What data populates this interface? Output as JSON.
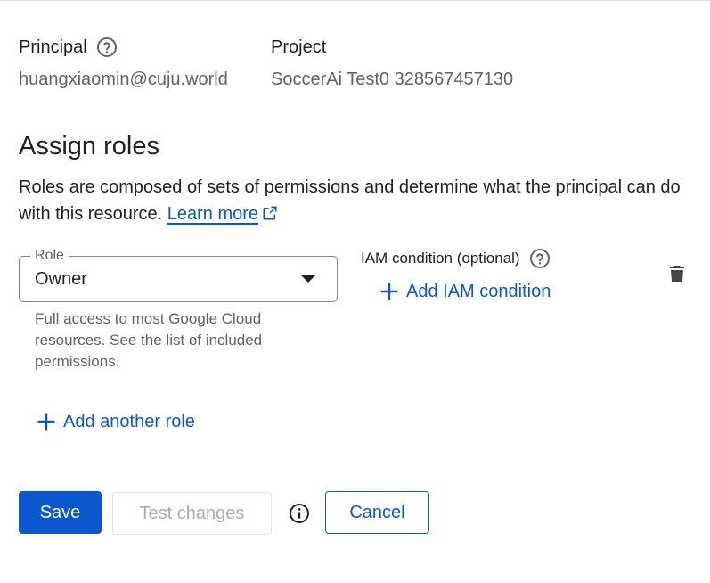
{
  "principal": {
    "label": "Principal",
    "value": "huangxiaomin@cuju.world"
  },
  "project": {
    "label": "Project",
    "value": "SoccerAi Test0 328567457130"
  },
  "assign_roles": {
    "title": "Assign roles",
    "description": "Roles are composed of sets of permissions and determine what the principal can do with this resource.",
    "learn_more": "Learn more"
  },
  "role_field": {
    "label": "Role",
    "value": "Owner",
    "helper": "Full access to most Google Cloud resources. See the list of included permissions."
  },
  "iam_condition": {
    "label": "IAM condition (optional)",
    "add_label": "Add IAM condition"
  },
  "add_role_label": "Add another role",
  "actions": {
    "save": "Save",
    "test_changes": "Test changes",
    "cancel": "Cancel"
  },
  "icons": {
    "help": "help-circle-icon",
    "external": "open-in-new-icon",
    "dropdown": "chevron-down-icon",
    "add": "plus-icon",
    "delete": "trash-icon",
    "info": "info-icon"
  },
  "colors": {
    "accent": "#0b57d0",
    "text": "#202124",
    "muted": "#5f6368",
    "disabled": "#a8abaf"
  }
}
